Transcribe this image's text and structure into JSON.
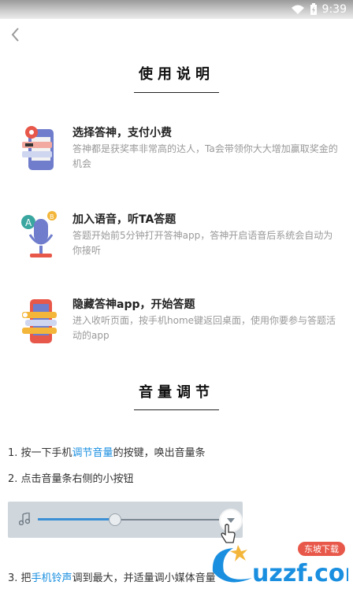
{
  "status_bar": {
    "time": "9:39"
  },
  "usage": {
    "title": "使用说明",
    "items": [
      {
        "title": "选择答神，支付小费",
        "desc": "答神都是获奖率非常高的达人，Ta会带领你大大增加赢取奖金的机会"
      },
      {
        "title": "加入语音，听TA答题",
        "desc": "答题开始前5分钟打开答神app，答神开启语音后系统会自动为你接听"
      },
      {
        "title": "隐藏答神app，开始答题",
        "desc": "进入收听页面，按手机home键返回桌面，使用你要参与答题活动的app"
      }
    ]
  },
  "volume": {
    "title": "音量调节",
    "step1": {
      "pre": "1. 按一下手机",
      "hl": "调节音量",
      "post": "的按键，唤出音量条"
    },
    "step2": {
      "text": "2. 点击音量条右侧的小按钮"
    },
    "step3": {
      "pre": "3. 把",
      "hl": "手机铃声",
      "post": "调到最大，并适量调小媒体音量"
    },
    "slider_level": 0.42
  },
  "watermark": {
    "site": "uzzf.com",
    "tag": "东坡下载"
  },
  "icons": {
    "back": "chevron-left-icon",
    "item1": "phone-reward-icon",
    "item2": "microphone-icon",
    "item3": "phone-layers-icon",
    "note": "music-note-icon",
    "volbtn": "chevron-down-icon"
  },
  "colors": {
    "accent": "#1a8fe0",
    "red": "#e8584a",
    "purple": "#6f7dcc",
    "yellow": "#f3b63a",
    "teal": "#3aa6a0"
  }
}
